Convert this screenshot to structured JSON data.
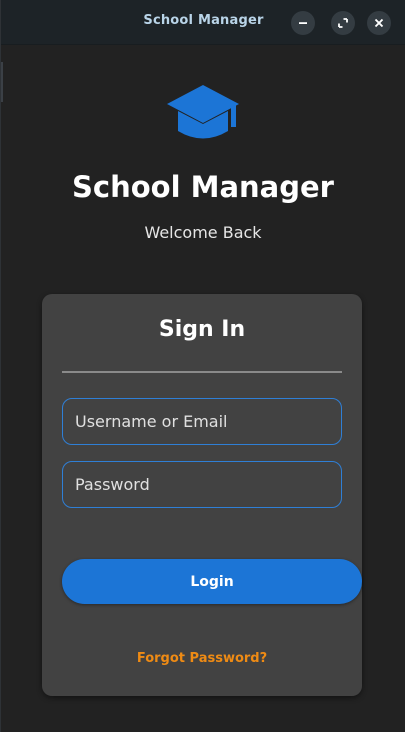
{
  "window": {
    "title": "School Manager",
    "controls": [
      "minimize-icon",
      "maximize-icon",
      "close-icon"
    ]
  },
  "header": {
    "logo_icon": "graduation-cap-icon",
    "app_title": "School Manager",
    "subtitle": "Welcome Back"
  },
  "login_card": {
    "title": "Sign In",
    "username": {
      "placeholder": "Username or Email",
      "value": ""
    },
    "password": {
      "placeholder": "Password",
      "value": ""
    },
    "login_label": "Login",
    "forgot_password_label": "Forgot Password?"
  },
  "colors": {
    "background": "#222222",
    "titlebar": "#1d2327",
    "card": "#424242",
    "accent": "#1c75d6",
    "field_border": "#2f7fd6",
    "link": "#ef8b14"
  }
}
